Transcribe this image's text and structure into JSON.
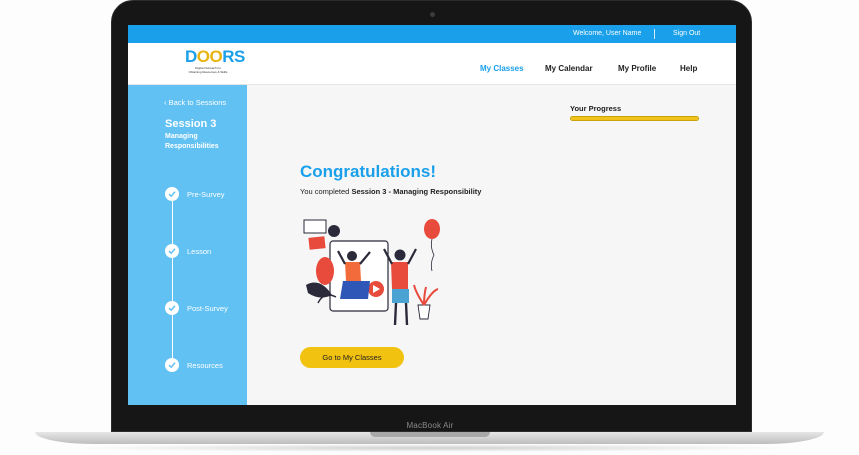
{
  "device": {
    "label": "MacBook Air"
  },
  "topbar": {
    "welcome": "Welcome, User Name",
    "sign_out": "Sign Out"
  },
  "logo": {
    "word": "DOORS",
    "tagline": "Digital Outreach for Obtaining Resources & Skills"
  },
  "nav": {
    "items": [
      "My Classes",
      "My Calendar",
      "My Profile",
      "Help"
    ],
    "active": "My Classes"
  },
  "sidebar": {
    "back": "Back to Sessions",
    "session_title": "Session 3",
    "session_subtitle": "Managing Responsibilities",
    "steps": [
      "Pre-Survey",
      "Lesson",
      "Post-Survey",
      "Resources"
    ]
  },
  "progress": {
    "label": "Your Progress",
    "value": 1.0
  },
  "main": {
    "heading": "Congratulations!",
    "completed_prefix": "You completed ",
    "completed_session": "Session 3 - Managing Responsibility",
    "cta": "Go to My Classes"
  },
  "colors": {
    "accent": "#1aa0ea",
    "sidebar": "#62c1f3",
    "yellow": "#f2c210"
  }
}
